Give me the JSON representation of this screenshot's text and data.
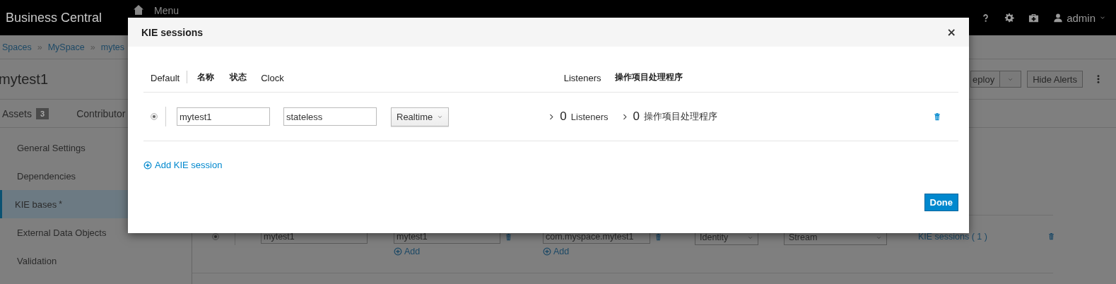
{
  "top_bar": {
    "brand": "Business Central",
    "menu": "Menu",
    "user": "admin"
  },
  "breadcrumb": [
    {
      "kind": "link",
      "text": "Spaces"
    },
    {
      "kind": "separator",
      "text": "»"
    },
    {
      "kind": "link",
      "text": "MySpace"
    },
    {
      "kind": "separator",
      "text": "»"
    },
    {
      "kind": "link",
      "text": "mytes"
    }
  ],
  "project": {
    "title": "mytest1",
    "buttons": [
      "eploy",
      "Hide Alerts"
    ]
  },
  "tabs": [
    {
      "label": "Assets",
      "count": "3"
    },
    {
      "label": "Contributor"
    }
  ],
  "sidebar": {
    "items": [
      {
        "label": "General Settings",
        "selected": false
      },
      {
        "label": "Dependencies",
        "selected": false
      },
      {
        "label": "KIE bases",
        "mark": "*",
        "selected": true
      },
      {
        "label": "External Data Objects",
        "selected": false
      },
      {
        "label": "Validation",
        "selected": false
      }
    ]
  },
  "kie_bases": [
    {
      "default": true,
      "name": "mytest1",
      "package": "mytest1",
      "package_add": "Add",
      "include": "com.myspace.mytest1",
      "include_add": "Add",
      "equals_behavior": "Identity",
      "event_mode": "Stream",
      "sessions_link": "KIE sessions ( 1 )"
    }
  ],
  "dialog": {
    "title": "KIE sessions",
    "close": "×",
    "columns": [
      "Default",
      "名称",
      "状态",
      "Clock",
      "Listeners",
      "操作项目处理程序"
    ],
    "sessions": [
      {
        "default": true,
        "name": "mytest1",
        "type": "stateless",
        "clock": "Realtime",
        "listeners_count": "0",
        "listeners_label": "Listeners",
        "handlers_count": "0",
        "handlers_label": "操作项目处理程序"
      }
    ],
    "add_label": "Add KIE session",
    "done": "Done"
  }
}
